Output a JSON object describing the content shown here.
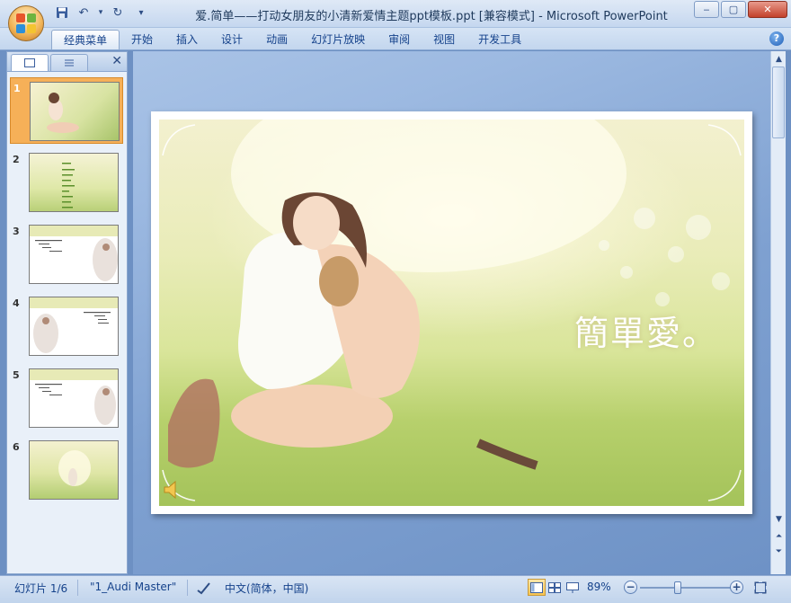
{
  "window": {
    "title": "爱.简单——打动女朋友的小清新爱情主题ppt模板.ppt [兼容模式] - Microsoft PowerPoint",
    "controls": {
      "minimize": "‒",
      "maximize": "▢",
      "close": "✕"
    }
  },
  "qat": {
    "save": "💾",
    "undo": "↶",
    "undo_dropdown": "▾",
    "redo": "↻",
    "customize": "▾"
  },
  "ribbon": {
    "tabs": [
      "经典菜单",
      "开始",
      "插入",
      "设计",
      "动画",
      "幻灯片放映",
      "审阅",
      "视图",
      "开发工具"
    ],
    "active_tab": 0,
    "help": "?"
  },
  "left_pane": {
    "close": "✕"
  },
  "slides": [
    {
      "num": "1",
      "selected": true
    },
    {
      "num": "2",
      "selected": false
    },
    {
      "num": "3",
      "selected": false
    },
    {
      "num": "4",
      "selected": false
    },
    {
      "num": "5",
      "selected": false
    },
    {
      "num": "6",
      "selected": false
    }
  ],
  "current_slide": {
    "title": "簡單愛。"
  },
  "statusbar": {
    "slide_counter": "幻灯片 1/6",
    "theme": "\"1_Audi Master\"",
    "language": "中文(简体，中国)",
    "zoom": "89%",
    "zoom_out": "−",
    "zoom_in": "+"
  },
  "colors": {
    "accent_selected": "#f6b058",
    "ribbon_text": "#15428b"
  }
}
